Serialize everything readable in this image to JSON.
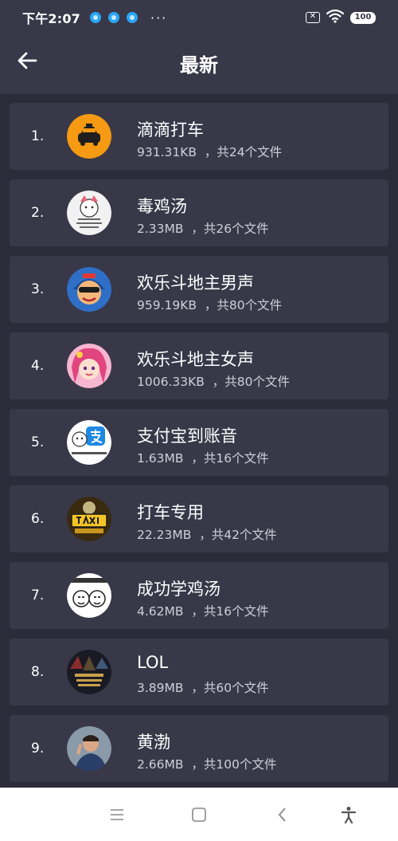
{
  "status_bar": {
    "time": "下午2:07",
    "more": "···",
    "sim_label": "✕",
    "battery_level": "100"
  },
  "header": {
    "title": "最新"
  },
  "items": [
    {
      "index": "1.",
      "name": "滴滴打车",
      "size": "931.31KB",
      "count": "，共24个文件",
      "icon": "taxi-car-icon"
    },
    {
      "index": "2.",
      "name": "毒鸡汤",
      "size": "2.33MB",
      "count": "，共26个文件",
      "icon": "cartoon-face-icon"
    },
    {
      "index": "3.",
      "name": "欢乐斗地主男声",
      "size": "959.19KB",
      "count": "，共80个文件",
      "icon": "cartoon-boy-icon"
    },
    {
      "index": "4.",
      "name": "欢乐斗地主女声",
      "size": "1006.33KB",
      "count": "，共80个文件",
      "icon": "cartoon-girl-icon"
    },
    {
      "index": "5.",
      "name": "支付宝到账音",
      "size": "1.63MB",
      "count": "，共16个文件",
      "icon": "alipay-icon"
    },
    {
      "index": "6.",
      "name": "打车专用",
      "size": "22.23MB",
      "count": "，共42个文件",
      "icon": "taxi-sign-icon"
    },
    {
      "index": "7.",
      "name": "成功学鸡汤",
      "size": "4.62MB",
      "count": "，共16个文件",
      "icon": "meme-faces-icon"
    },
    {
      "index": "8.",
      "name": "LOL",
      "size": "3.89MB",
      "count": "，共60个文件",
      "icon": "league-of-legends-icon"
    },
    {
      "index": "9.",
      "name": "黄渤",
      "size": "2.66MB",
      "count": "，共100个文件",
      "icon": "person-photo-icon"
    }
  ],
  "colors": {
    "background": "#2c2b3a",
    "card": "#393849",
    "header": "#393849",
    "meta_text": "#cfcfd8",
    "nav_bar": "#ffffff"
  }
}
